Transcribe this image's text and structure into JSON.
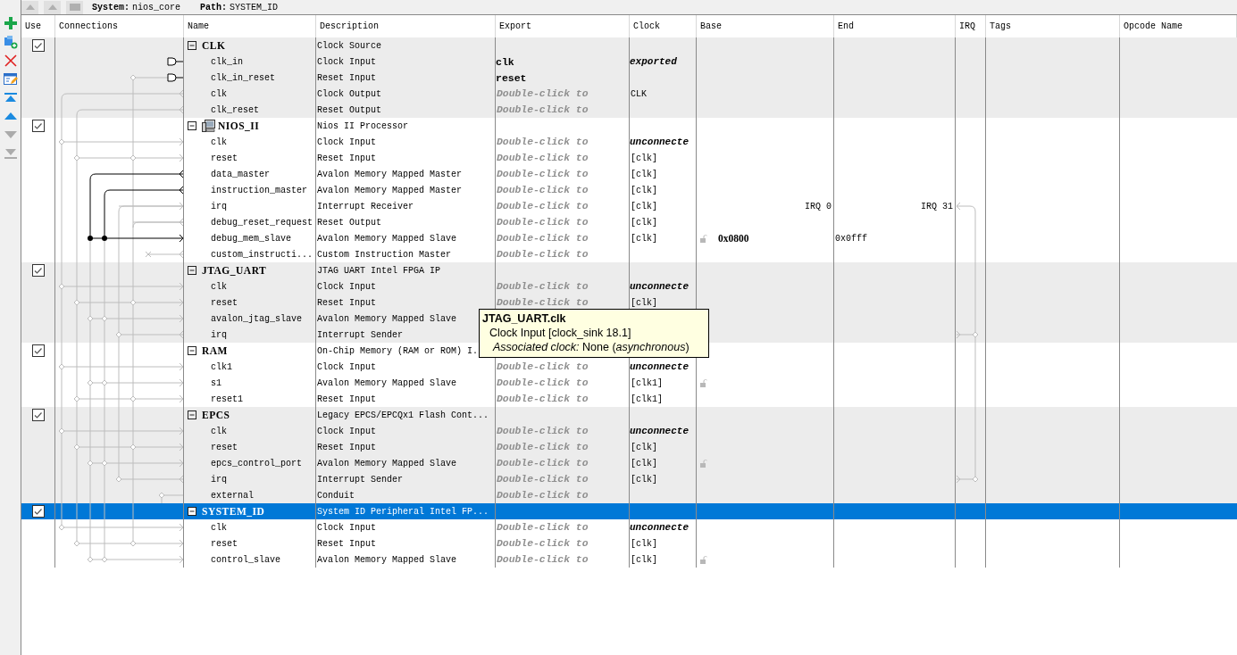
{
  "toolbar": [
    {
      "kind": "add",
      "disabled": false
    },
    {
      "kind": "add_module",
      "disabled": false
    },
    {
      "kind": "remove",
      "disabled": false
    },
    {
      "kind": "edit",
      "disabled": false
    },
    {
      "kind": "move_top",
      "disabled": false
    },
    {
      "kind": "move_up",
      "disabled": false
    },
    {
      "kind": "move_down",
      "disabled": true
    },
    {
      "kind": "move_bottom",
      "disabled": true
    }
  ],
  "top_bar": {
    "system_label": "System:",
    "system": "nios_core",
    "path_label": "Path:",
    "path": "SYSTEM_ID"
  },
  "columns": [
    "Use",
    "Connections",
    "Name",
    "Description",
    "Export",
    "Clock",
    "Base",
    "End",
    "IRQ",
    "Tags",
    "Opcode Name"
  ],
  "modules": [
    {
      "name": "CLK",
      "description": "Clock Source",
      "kind": "component",
      "use": true,
      "expanded": true,
      "selected": false,
      "ports": [
        {
          "name": "clk_in",
          "description": "Clock Input",
          "export": {
            "text": "clk",
            "kind": "name"
          },
          "clock": {
            "text": "exported",
            "kind": "status"
          },
          "locked": false
        },
        {
          "name": "clk_in_reset",
          "description": "Reset Input",
          "export": {
            "text": "reset",
            "kind": "name"
          },
          "locked": false
        },
        {
          "name": "clk",
          "description": "Clock Output",
          "export": {
            "text": "Double-click to",
            "kind": "hint"
          },
          "clock": {
            "text": "CLK",
            "kind": "name"
          },
          "locked": false
        },
        {
          "name": "clk_reset",
          "description": "Reset Output",
          "export": {
            "text": "Double-click to",
            "kind": "hint"
          },
          "locked": false
        }
      ]
    },
    {
      "name": "NIOS_II",
      "description": "Nios II Processor",
      "kind": "processor",
      "use": true,
      "expanded": true,
      "selected": false,
      "ports": [
        {
          "name": "clk",
          "description": "Clock Input",
          "export": {
            "text": "Double-click to",
            "kind": "hint"
          },
          "clock": {
            "text": "unconnecte",
            "kind": "status"
          },
          "locked": false
        },
        {
          "name": "reset",
          "description": "Reset Input",
          "export": {
            "text": "Double-click to",
            "kind": "hint"
          },
          "clock": {
            "text": "[clk]",
            "kind": "name"
          },
          "locked": false
        },
        {
          "name": "data_master",
          "description": "Avalon Memory Mapped Master",
          "export": {
            "text": "Double-click to",
            "kind": "hint"
          },
          "clock": {
            "text": "[clk]",
            "kind": "name"
          },
          "locked": false
        },
        {
          "name": "instruction_master",
          "description": "Avalon Memory Mapped Master",
          "export": {
            "text": "Double-click to",
            "kind": "hint"
          },
          "clock": {
            "text": "[clk]",
            "kind": "name"
          },
          "locked": false
        },
        {
          "name": "irq",
          "description": "Interrupt Receiver",
          "export": {
            "text": "Double-click to",
            "kind": "hint"
          },
          "clock": {
            "text": "[clk]",
            "kind": "name"
          },
          "base": {
            "text": "IRQ 0",
            "kind": "irq"
          },
          "end": {
            "text": "IRQ 31",
            "kind": "irq"
          },
          "locked": false
        },
        {
          "name": "debug_reset_request",
          "description": "Reset Output",
          "export": {
            "text": "Double-click to",
            "kind": "hint"
          },
          "clock": {
            "text": "[clk]",
            "kind": "name"
          },
          "locked": false
        },
        {
          "name": "debug_mem_slave",
          "description": "Avalon Memory Mapped Slave",
          "export": {
            "text": "Double-click to",
            "kind": "hint"
          },
          "clock": {
            "text": "[clk]",
            "kind": "name"
          },
          "base": {
            "text": "0x0800",
            "kind": "address"
          },
          "end": {
            "text": "0x0fff",
            "kind": "address"
          },
          "locked": true
        },
        {
          "name": "custom_instructi...",
          "description": "Custom Instruction Master",
          "export": {
            "text": "Double-click to",
            "kind": "hint"
          },
          "locked": false
        }
      ]
    },
    {
      "name": "JTAG_UART",
      "description": "JTAG UART Intel FPGA IP",
      "kind": "component",
      "use": true,
      "expanded": true,
      "selected": false,
      "ports": [
        {
          "name": "clk",
          "description": "Clock Input",
          "export": {
            "text": "Double-click to",
            "kind": "hint"
          },
          "clock": {
            "text": "unconnecte",
            "kind": "status"
          },
          "locked": false
        },
        {
          "name": "reset",
          "description": "Reset Input",
          "export": {
            "text": "Double-click to",
            "kind": "hint"
          },
          "clock": {
            "text": "[clk]",
            "kind": "name"
          },
          "locked": false
        },
        {
          "name": "avalon_jtag_slave",
          "description": "Avalon Memory Mapped Slave",
          "locked": false
        },
        {
          "name": "irq",
          "description": "Interrupt Sender",
          "locked": false
        }
      ]
    },
    {
      "name": "RAM",
      "description": "On-Chip Memory (RAM or ROM) I.",
      "kind": "component",
      "use": true,
      "expanded": true,
      "selected": false,
      "ports": [
        {
          "name": "clk1",
          "description": "Clock Input",
          "export": {
            "text": "Double-click to",
            "kind": "hint"
          },
          "clock": {
            "text": "unconnecte",
            "kind": "status"
          },
          "locked": false
        },
        {
          "name": "s1",
          "description": "Avalon Memory Mapped Slave",
          "export": {
            "text": "Double-click to",
            "kind": "hint"
          },
          "clock": {
            "text": "[clk1]",
            "kind": "name"
          },
          "locked": true
        },
        {
          "name": "reset1",
          "description": "Reset Input",
          "export": {
            "text": "Double-click to",
            "kind": "hint"
          },
          "clock": {
            "text": "[clk1]",
            "kind": "name"
          },
          "locked": false
        }
      ]
    },
    {
      "name": "EPCS",
      "description": "Legacy EPCS/EPCQx1 Flash Cont...",
      "kind": "component",
      "use": true,
      "expanded": true,
      "selected": false,
      "ports": [
        {
          "name": "clk",
          "description": "Clock Input",
          "export": {
            "text": "Double-click to",
            "kind": "hint"
          },
          "clock": {
            "text": "unconnecte",
            "kind": "status"
          },
          "locked": false
        },
        {
          "name": "reset",
          "description": "Reset Input",
          "export": {
            "text": "Double-click to",
            "kind": "hint"
          },
          "clock": {
            "text": "[clk]",
            "kind": "name"
          },
          "locked": false
        },
        {
          "name": "epcs_control_port",
          "description": "Avalon Memory Mapped Slave",
          "export": {
            "text": "Double-click to",
            "kind": "hint"
          },
          "clock": {
            "text": "[clk]",
            "kind": "name"
          },
          "locked": true
        },
        {
          "name": "irq",
          "description": "Interrupt Sender",
          "export": {
            "text": "Double-click to",
            "kind": "hint"
          },
          "clock": {
            "text": "[clk]",
            "kind": "name"
          },
          "locked": false
        },
        {
          "name": "external",
          "description": "Conduit",
          "export": {
            "text": "Double-click to",
            "kind": "hint"
          },
          "locked": false
        }
      ]
    },
    {
      "name": "SYSTEM_ID",
      "description": "System ID Peripheral Intel FP...",
      "kind": "component",
      "use": true,
      "expanded": true,
      "selected": true,
      "ports": [
        {
          "name": "clk",
          "description": "Clock Input",
          "export": {
            "text": "Double-click to",
            "kind": "hint"
          },
          "clock": {
            "text": "unconnecte",
            "kind": "status"
          },
          "locked": false
        },
        {
          "name": "reset",
          "description": "Reset Input",
          "export": {
            "text": "Double-click to",
            "kind": "hint"
          },
          "clock": {
            "text": "[clk]",
            "kind": "name"
          },
          "locked": false
        },
        {
          "name": "control_slave",
          "description": "Avalon Memory Mapped Slave",
          "export": {
            "text": "Double-click to",
            "kind": "hint"
          },
          "clock": {
            "text": "[clk]",
            "kind": "name"
          },
          "locked": true
        }
      ]
    }
  ],
  "tooltip": {
    "title": "JTAG_UART.clk",
    "line": "Clock Input [clock_sink 18.1]",
    "detail": "*Associated clock:*  None (*asynchronous*)"
  }
}
